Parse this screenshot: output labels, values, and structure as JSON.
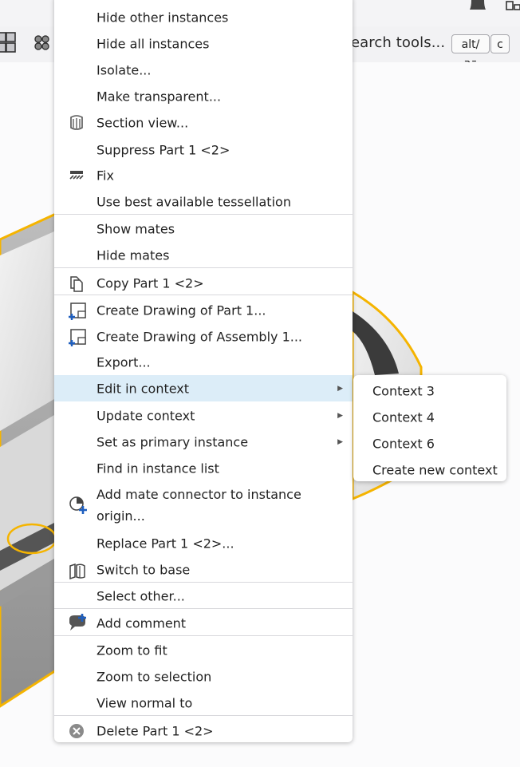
{
  "toolbar": {
    "search_text": "earch tools...",
    "shortcut_key_1": "alt/⌥",
    "shortcut_key_2": "c"
  },
  "context_menu": {
    "items": [
      {
        "label": "Hide other instances"
      },
      {
        "label": "Hide all instances"
      },
      {
        "label": "Isolate..."
      },
      {
        "label": "Make transparent..."
      },
      {
        "label": "Section view...",
        "icon": "section-view-icon"
      },
      {
        "label": "Suppress Part 1 <2>"
      },
      {
        "label": "Fix",
        "icon": "fix-icon"
      },
      {
        "label": "Use best available tessellation"
      },
      {
        "label": "Show mates"
      },
      {
        "label": "Hide mates"
      },
      {
        "label": "Copy Part 1 <2>",
        "icon": "copy-icon"
      },
      {
        "label": "Create Drawing of Part 1...",
        "icon": "create-drawing-icon"
      },
      {
        "label": "Create Drawing of Assembly 1...",
        "icon": "create-drawing-icon"
      },
      {
        "label": "Export..."
      },
      {
        "label": "Edit in context",
        "has_submenu": true,
        "highlighted": true
      },
      {
        "label": "Update context",
        "has_submenu": true
      },
      {
        "label": "Set as primary instance",
        "has_submenu": true
      },
      {
        "label": "Find in instance list"
      },
      {
        "label": "Add mate connector to instance origin...",
        "icon": "mate-connector-icon"
      },
      {
        "label": "Replace Part 1 <2>..."
      },
      {
        "label": "Switch to base",
        "icon": "switch-to-base-icon"
      },
      {
        "label": "Select other..."
      },
      {
        "label": "Add comment",
        "icon": "add-comment-icon"
      },
      {
        "label": "Zoom to fit"
      },
      {
        "label": "Zoom to selection"
      },
      {
        "label": "View normal to"
      },
      {
        "label": "Delete Part 1 <2>",
        "icon": "delete-icon"
      }
    ],
    "submenu_arrow": "▶"
  },
  "submenu": {
    "items": [
      {
        "label": "Context 3"
      },
      {
        "label": "Context 4"
      },
      {
        "label": "Context 6"
      },
      {
        "label": "Create new context"
      }
    ]
  },
  "colors": {
    "highlight": "#dcedf8",
    "selection_outline": "#f5b400",
    "icon_blue": "#1f5fbf"
  }
}
